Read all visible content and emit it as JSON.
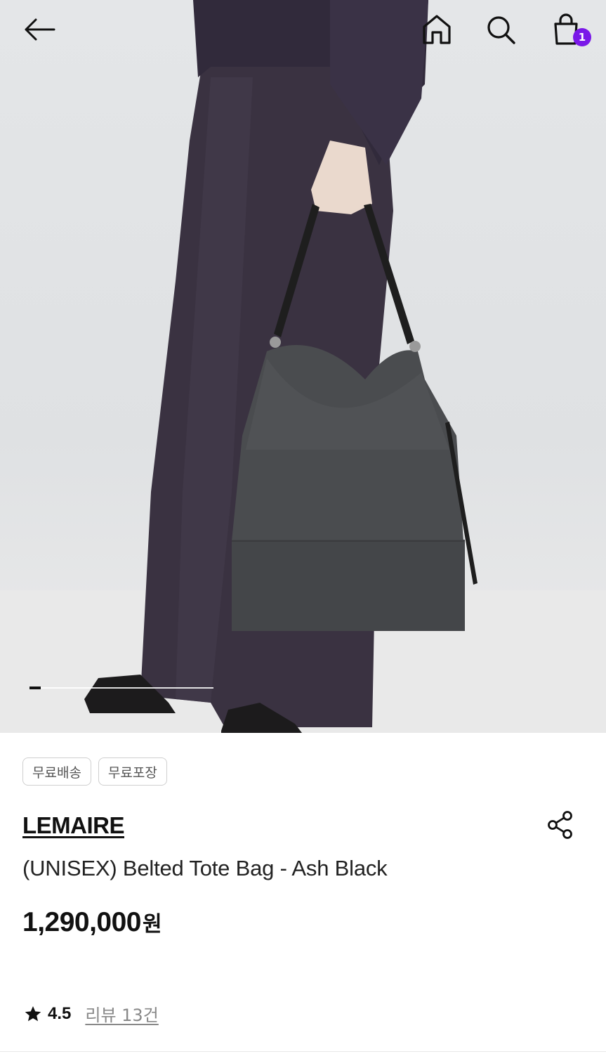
{
  "header": {
    "back_icon": "arrow-left-icon",
    "home_icon": "home-icon",
    "search_icon": "search-icon",
    "cart_icon": "shopping-bag-icon",
    "cart_count": "1",
    "badge_color": "#7a18e8"
  },
  "gallery": {
    "current_index": 1,
    "progress_fraction": 0.06
  },
  "tags": [
    "무료배송",
    "무료포장"
  ],
  "product": {
    "brand": "LEMAIRE",
    "name": "(UNISEX) Belted Tote Bag - Ash Black",
    "price": "1,290,000",
    "currency": "원",
    "share_icon": "share-icon"
  },
  "rating": {
    "star_icon": "star-icon",
    "score": "4.5",
    "review_label": "리뷰 13건"
  }
}
